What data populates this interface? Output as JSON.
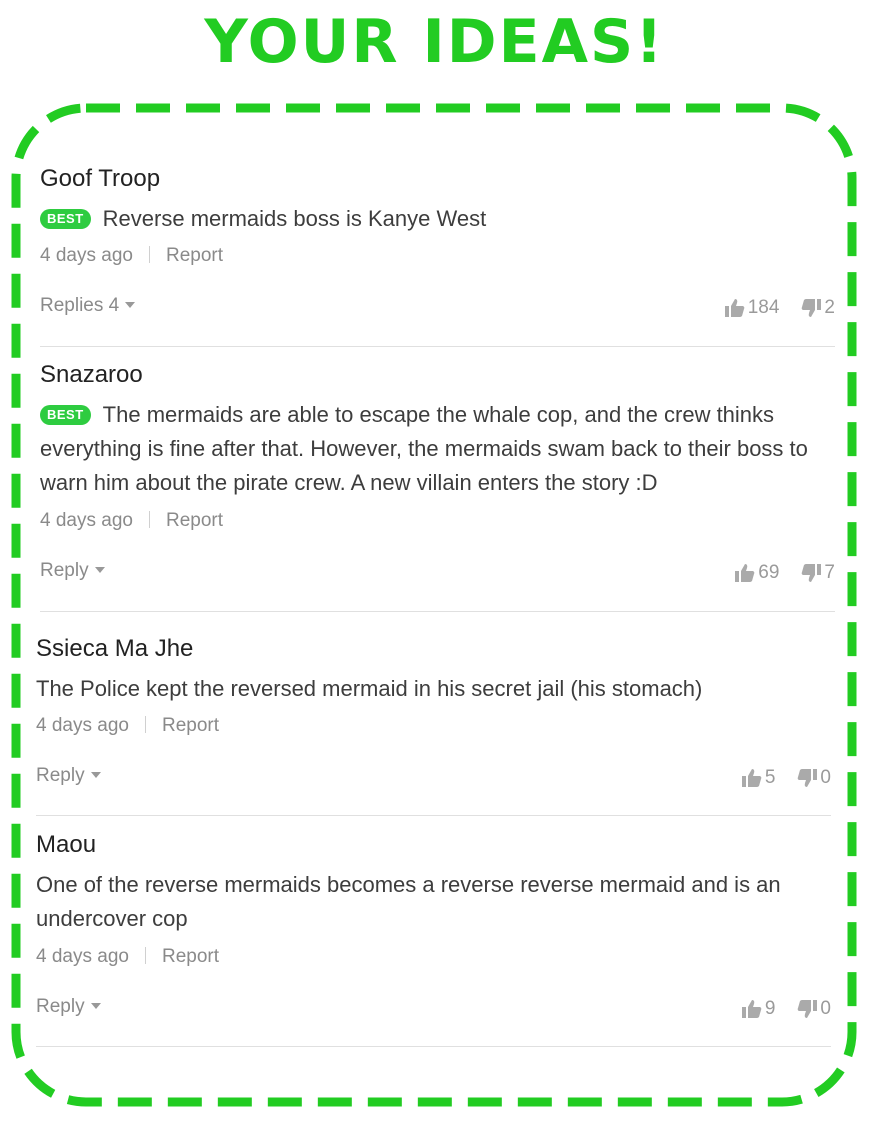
{
  "title": "YOUR IDEAS!",
  "accent_color": "#22cc22",
  "badge_color": "#2ecc40",
  "comments": [
    {
      "author": "Goof Troop",
      "badge": "BEST",
      "text": "Reverse mermaids boss is Kanye West",
      "time": "4 days ago",
      "report": "Report",
      "reply_label": "Replies",
      "reply_count": "4",
      "upvotes": "184",
      "downvotes": "2"
    },
    {
      "author": "Snazaroo",
      "badge": "BEST",
      "text": "The mermaids are able to escape the whale cop, and the crew thinks everything is fine after that. However, the mermaids swam back to their boss to warn him about the pirate crew. A new villain enters the story :D",
      "time": "4 days ago",
      "report": "Report",
      "reply_label": "Reply",
      "reply_count": "",
      "upvotes": "69",
      "downvotes": "7"
    },
    {
      "author": "Ssieca Ma Jhe",
      "badge": "",
      "text": "The Police kept the reversed mermaid in his secret jail (his stomach)",
      "time": "4 days ago",
      "report": "Report",
      "reply_label": "Reply",
      "reply_count": "",
      "upvotes": "5",
      "downvotes": "0"
    },
    {
      "author": "Maou",
      "badge": "",
      "text": "One of the reverse mermaids becomes a reverse reverse mermaid and is an undercover cop",
      "time": "4 days ago",
      "report": "Report",
      "reply_label": "Reply",
      "reply_count": "",
      "upvotes": "9",
      "downvotes": "0"
    }
  ]
}
